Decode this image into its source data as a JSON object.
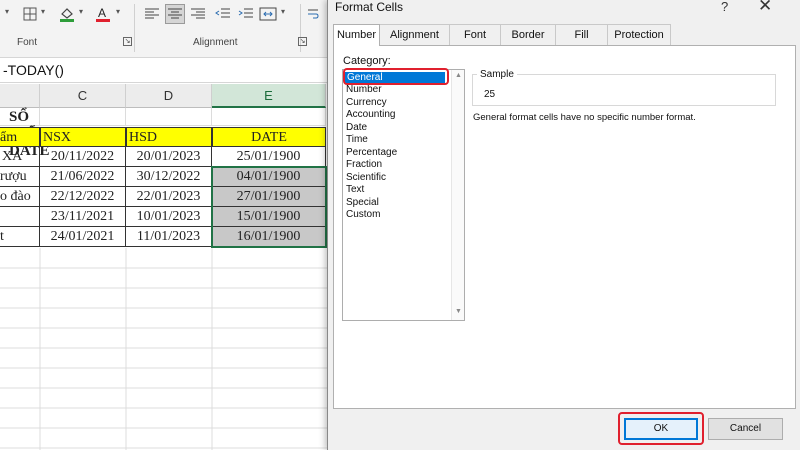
{
  "ribbon": {
    "font_group_label": "Font",
    "alignment_group_label": "Alignment"
  },
  "formula_bar": {
    "text": "-TODAY()"
  },
  "sheet": {
    "columns": [
      "C",
      "D",
      "E"
    ],
    "title": "SỔ KIỂM DATE",
    "headers": [
      "ẩm",
      "NSX",
      "HSD",
      "DATE"
    ],
    "rows": [
      [
        "XA",
        "20/11/2022",
        "20/01/2023",
        "25/01/1900"
      ],
      [
        "rượu",
        "21/06/2022",
        "30/12/2022",
        "04/01/1900"
      ],
      [
        "o đào",
        "22/12/2022",
        "22/01/2023",
        "27/01/1900"
      ],
      [
        "",
        "23/11/2021",
        "10/01/2023",
        "15/01/1900"
      ],
      [
        "t",
        "24/01/2021",
        "11/01/2023",
        "16/01/1900"
      ]
    ]
  },
  "dialog": {
    "title": "Format Cells",
    "help": "?",
    "close": "✕",
    "tabs": [
      "Number",
      "Alignment",
      "Font",
      "Border",
      "Fill",
      "Protection"
    ],
    "category_label": "Category:",
    "categories": [
      "General",
      "Number",
      "Currency",
      "Accounting",
      "Date",
      "Time",
      "Percentage",
      "Fraction",
      "Scientific",
      "Text",
      "Special",
      "Custom"
    ],
    "selected_category": "General",
    "sample_label": "Sample",
    "sample_value": "25",
    "description": "General format cells have no specific number format.",
    "ok_label": "OK",
    "cancel_label": "Cancel"
  },
  "colors": {
    "header_fill": "#ffff00",
    "selected_fill": "#c8c8c8",
    "highlight_ring": "#e0202e",
    "accent": "#0078d7",
    "excel_green": "#217346"
  }
}
